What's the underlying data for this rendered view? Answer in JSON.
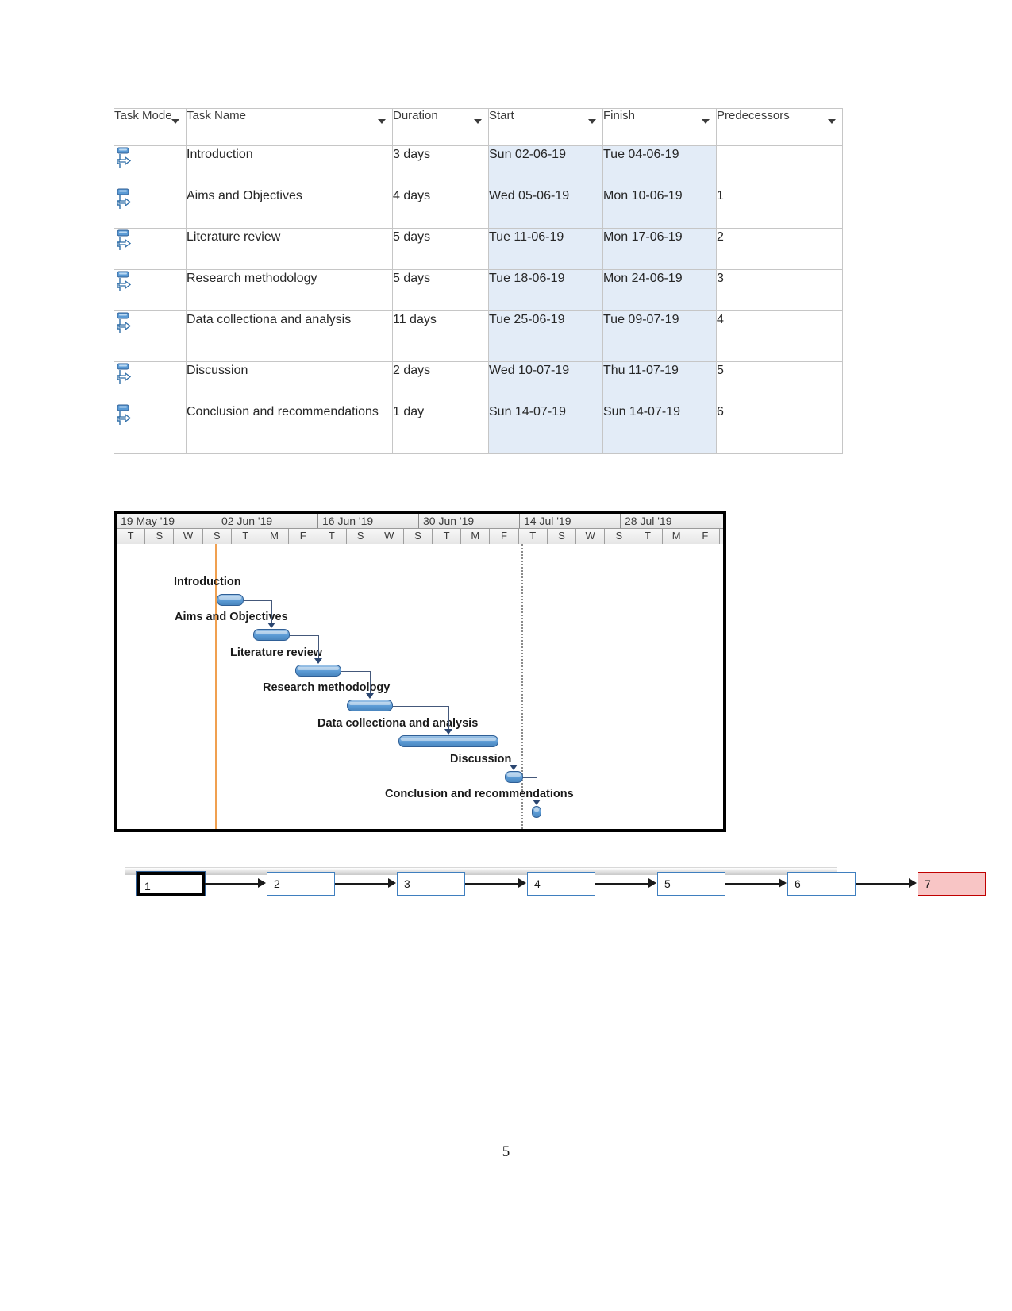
{
  "table": {
    "columns": [
      {
        "key": "task_mode",
        "label": "Task Mode",
        "highlight": false
      },
      {
        "key": "task_name",
        "label": "Task Name",
        "highlight": false
      },
      {
        "key": "duration",
        "label": "Duration",
        "highlight": false
      },
      {
        "key": "start",
        "label": "Start",
        "highlight": false
      },
      {
        "key": "finish",
        "label": "Finish",
        "highlight": true
      },
      {
        "key": "predecessors",
        "label": "Predecessors",
        "highlight": false
      }
    ],
    "highlight_color": "#ffd24d",
    "selected_column_color": "#e3ecf7",
    "rows": [
      {
        "id": 1,
        "task_name": "Introduction",
        "duration": "3 days",
        "start": "Sun 02-06-19",
        "finish": "Tue 04-06-19",
        "predecessors": ""
      },
      {
        "id": 2,
        "task_name": "Aims and Objectives",
        "duration": "4 days",
        "start": "Wed 05-06-19",
        "finish": "Mon 10-06-19",
        "predecessors": "1"
      },
      {
        "id": 3,
        "task_name": "Literature review",
        "duration": "5 days",
        "start": "Tue 11-06-19",
        "finish": "Mon 17-06-19",
        "predecessors": "2"
      },
      {
        "id": 4,
        "task_name": "Research methodology",
        "duration": "5 days",
        "start": "Tue 18-06-19",
        "finish": "Mon 24-06-19",
        "predecessors": "3"
      },
      {
        "id": 5,
        "task_name": "Data collectiona and analysis",
        "duration": "11 days",
        "start": "Tue 25-06-19",
        "finish": "Tue 09-07-19",
        "predecessors": "4"
      },
      {
        "id": 6,
        "task_name": "Discussion",
        "duration": "2 days",
        "start": "Wed 10-07-19",
        "finish": "Thu 11-07-19",
        "predecessors": "5"
      },
      {
        "id": 7,
        "task_name": "Conclusion and recommendations",
        "duration": "1 day",
        "start": "Sun 14-07-19",
        "finish": "Sun 14-07-19",
        "predecessors": "6"
      }
    ]
  },
  "chart_data": {
    "type": "bar",
    "subtype": "gantt",
    "title": "",
    "xlabel": "",
    "ylabel": "",
    "grid": false,
    "legend": "none",
    "timeline_weeks": [
      "19 May '19",
      "02 Jun '19",
      "16 Jun '19",
      "30 Jun '19",
      "14 Jul '19",
      "28 Jul '19"
    ],
    "timeline_days": [
      "T",
      "S",
      "W",
      "S",
      "T",
      "M",
      "F",
      "T",
      "S",
      "W",
      "S",
      "T",
      "M",
      "F",
      "T",
      "S",
      "W",
      "S",
      "T",
      "M",
      "F"
    ],
    "today_line_color": "#f0a050",
    "status_line_color": "#8a8a8a",
    "bar_color": "#5b9bd5",
    "tasks": [
      {
        "name": "Introduction",
        "start": "Sun 02-06-19",
        "finish": "Tue 04-06-19",
        "duration_days": 3,
        "left_pct": 16.5,
        "width_pct": 4.5
      },
      {
        "name": "Aims and Objectives",
        "start": "Wed 05-06-19",
        "finish": "Mon 10-06-19",
        "duration_days": 4,
        "left_pct": 22.5,
        "width_pct": 6.0
      },
      {
        "name": "Literature review",
        "start": "Tue 11-06-19",
        "finish": "Mon 17-06-19",
        "duration_days": 5,
        "left_pct": 29.5,
        "width_pct": 7.5
      },
      {
        "name": "Research methodology",
        "start": "Tue 18-06-19",
        "finish": "Mon 24-06-19",
        "duration_days": 5,
        "left_pct": 38.0,
        "width_pct": 7.5
      },
      {
        "name": "Data collectiona and analysis",
        "start": "Tue 25-06-19",
        "finish": "Tue 09-07-19",
        "duration_days": 11,
        "left_pct": 46.5,
        "width_pct": 16.5
      },
      {
        "name": "Discussion",
        "start": "Wed 10-07-19",
        "finish": "Thu 11-07-19",
        "duration_days": 2,
        "left_pct": 64.0,
        "width_pct": 3.0
      },
      {
        "name": "Conclusion and recommendations",
        "start": "Sun 14-07-19",
        "finish": "Sun 14-07-19",
        "duration_days": 1,
        "left_pct": 68.5,
        "width_pct": 1.5
      }
    ]
  },
  "network": {
    "nodes": [
      {
        "id": "1",
        "label": "1",
        "style": "critical-start"
      },
      {
        "id": "2",
        "label": "2",
        "style": "normal"
      },
      {
        "id": "3",
        "label": "3",
        "style": "normal"
      },
      {
        "id": "4",
        "label": "4",
        "style": "normal"
      },
      {
        "id": "5",
        "label": "5",
        "style": "normal"
      },
      {
        "id": "6",
        "label": "6",
        "style": "normal"
      },
      {
        "id": "7",
        "label": "7",
        "style": "finish"
      }
    ],
    "normal_border_color": "#3f7fbf",
    "finish_fill_color": "#f8c5c5",
    "finish_border_color": "#c00000"
  },
  "page": {
    "number": "5"
  }
}
